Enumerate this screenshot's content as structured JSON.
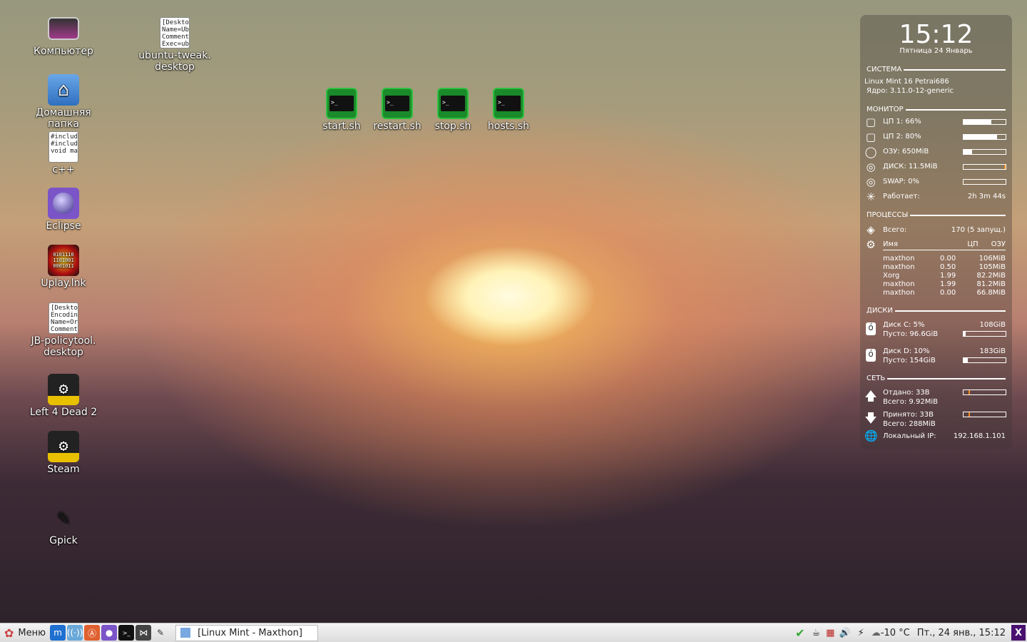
{
  "desktop_icons": [
    {
      "label": "Компьютер",
      "icon": "computer-icon"
    },
    {
      "label": "Домашняя папка",
      "icon": "home-folder-icon"
    },
    {
      "label": "c++",
      "icon": "text-file-icon",
      "preview": "#includ #includ void ma"
    },
    {
      "label": "Eclipse",
      "icon": "eclipse-icon"
    },
    {
      "label": "Uplay.lnk",
      "icon": "uplay-icon",
      "preview": "0101110 1101001 0001011"
    },
    {
      "label": "JB-policytool.\ndesktop",
      "icon": "desktop-file-icon",
      "preview": "[Deskto Encodin Name=Or Comment"
    },
    {
      "label": "Left 4 Dead 2",
      "icon": "steam-icon"
    },
    {
      "label": "Steam",
      "icon": "steam-icon"
    },
    {
      "label": "Gpick",
      "icon": "color-picker-icon"
    },
    {
      "label": "ubuntu-tweak.\ndesktop",
      "icon": "desktop-file-icon",
      "preview": "[Deskto Name=Ub Comment Exec=ub"
    },
    {
      "label": "start.sh",
      "icon": "terminal-icon"
    },
    {
      "label": "restart.sh",
      "icon": "terminal-icon"
    },
    {
      "label": "stop.sh",
      "icon": "terminal-icon"
    },
    {
      "label": "hosts.sh",
      "icon": "terminal-icon"
    }
  ],
  "conky": {
    "time": "15:12",
    "date": "Пятница 24 Январь",
    "system": {
      "header": "СИСТЕМА",
      "os": "Linux Mint 16 Petrai686",
      "kernel": "Ядро: 3.11.0-12-generic"
    },
    "monitor": {
      "header": "МОНИТОР",
      "items": [
        {
          "label": "ЦП 1: 66%",
          "percent": 66
        },
        {
          "label": "ЦП 2: 80%",
          "percent": 80
        },
        {
          "label": "ОЗУ: 650MiB",
          "percent": 20
        },
        {
          "label": "ДИСК: 11.5MiB",
          "percent": 3
        },
        {
          "label": "SWAP: 0%",
          "percent": 0
        }
      ],
      "uptime_label": "Работает:",
      "uptime": "2h 3m 44s"
    },
    "processes": {
      "header": "ПРОЦЕССЫ",
      "total_label": "Всего:",
      "total": "170 (5 запущ.)",
      "col_name": "Имя",
      "col_cpu": "ЦП",
      "col_mem": "ОЗУ",
      "rows": [
        [
          "maxthon",
          "0.00",
          "106MiB"
        ],
        [
          "maxthon",
          "0.50",
          "105MiB"
        ],
        [
          "Xorg",
          "1.99",
          "82.2MiB"
        ],
        [
          "maxthon",
          "1.99",
          "81.2MiB"
        ],
        [
          "maxthon",
          "0.00",
          "66.8MiB"
        ]
      ]
    },
    "disks": {
      "header": "ДИСКИ",
      "items": [
        {
          "label": "Диск C: 5%",
          "size": "108GiB",
          "free": "Пусто: 96.6GiB",
          "percent": 5
        },
        {
          "label": "Диск D: 10%",
          "size": "183GiB",
          "free": "Пусто: 154GiB",
          "percent": 10
        }
      ]
    },
    "network": {
      "header": "СЕТЬ",
      "up": "Отдано: 33B",
      "up_total": "Всего: 9.92MiB",
      "down": "Принято: 33B",
      "down_total": "Всего: 288MiB",
      "ip_label": "Локальный IP:",
      "ip": "192.168.1.101"
    }
  },
  "taskbar": {
    "menu_label": "Меню",
    "window": "[Linux Mint - Maxthon]",
    "weather": "-10 °C",
    "clock": "Пт., 24 янв., 15:12"
  },
  "colors": {
    "accent_orange": "#f08a20"
  }
}
